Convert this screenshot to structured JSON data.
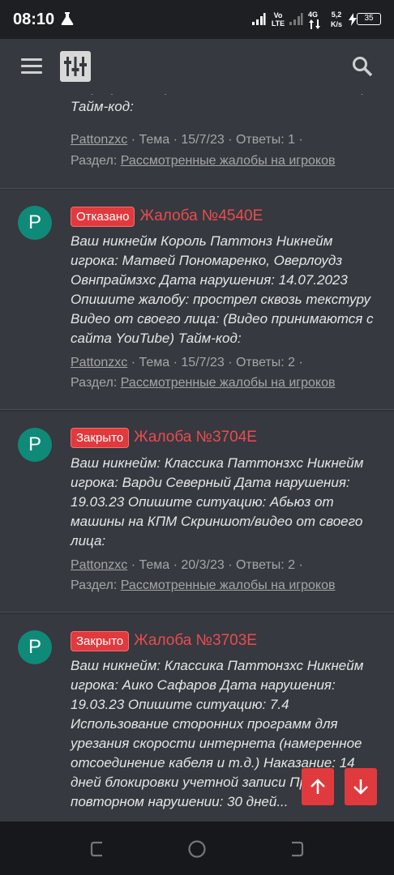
{
  "status_bar": {
    "time": "08:10",
    "volte": "Vo\nLTE",
    "network": "4G",
    "speed_value": "5,2",
    "speed_unit": "K/s",
    "battery": "35"
  },
  "app_bar": {
    "menu_icon": "hamburger-icon",
    "logo_icon": "equalizer-sliders-icon",
    "search_icon": "search-icon"
  },
  "partial_top": {
    "snippet_end": "лица: (Видео принимаются с сайта YouTube) Тайм-код:",
    "author": "Pattonzxc",
    "type": "Тема",
    "date": "15/7/23",
    "replies": "Ответы: 1",
    "section_label": "Раздел:",
    "section": "Рассмотренные жалобы на игроков"
  },
  "threads": [
    {
      "avatar": "P",
      "badge": "Отказано",
      "title": "Жалоба №4540Е",
      "snippet": "Ваш никнейм Король Паттонз Никнейм игрока: Матвей Пономаренко, Оверлоудз Овнпраймзхс Дата нарушения: 14.07.2023 Опишите жалобу: прострел сквозь текстуру Видео от своего лица: (Видео принимаются с сайта YouTube) Тайм-код:",
      "author": "Pattonzxc",
      "type": "Тема",
      "date": "15/7/23",
      "replies": "Ответы: 2",
      "section_label": "Раздел:",
      "section": "Рассмотренные жалобы на игроков"
    },
    {
      "avatar": "P",
      "badge": "Закрыто",
      "title": "Жалоба №3704Е",
      "snippet": "Ваш никнейм: Классика Паттонзхс Никнейм игрока: Варди Северный Дата нарушения: 19.03.23 Опишите ситуацию: Абьюз от машины на КПМ Скриншот/видео от своего лица:",
      "author": "Pattonzxc",
      "type": "Тема",
      "date": "20/3/23",
      "replies": "Ответы: 2",
      "section_label": "Раздел:",
      "section": "Рассмотренные жалобы на игроков"
    },
    {
      "avatar": "P",
      "badge": "Закрыто",
      "title": "Жалоба №3703Е",
      "snippet": "Ваш никнейм: Классика Паттонзхс Никнейм игрока: Аико Сафаров Дата нарушения: 19.03.23 Опишите ситуацию: 7.4 Использование сторонних программ для урезания скорости интернета (намеренное отсоединение кабеля и т.д.) Наказание: 14 дней блокировки учетной записи При повторном нарушении: 30 дней..."
    }
  ],
  "fabs": {
    "up_icon": "arrow-up-icon",
    "down_icon": "arrow-down-icon"
  },
  "nav_bar": {
    "back_icon": "back-icon",
    "home_icon": "home-icon",
    "recents_icon": "recents-icon"
  }
}
